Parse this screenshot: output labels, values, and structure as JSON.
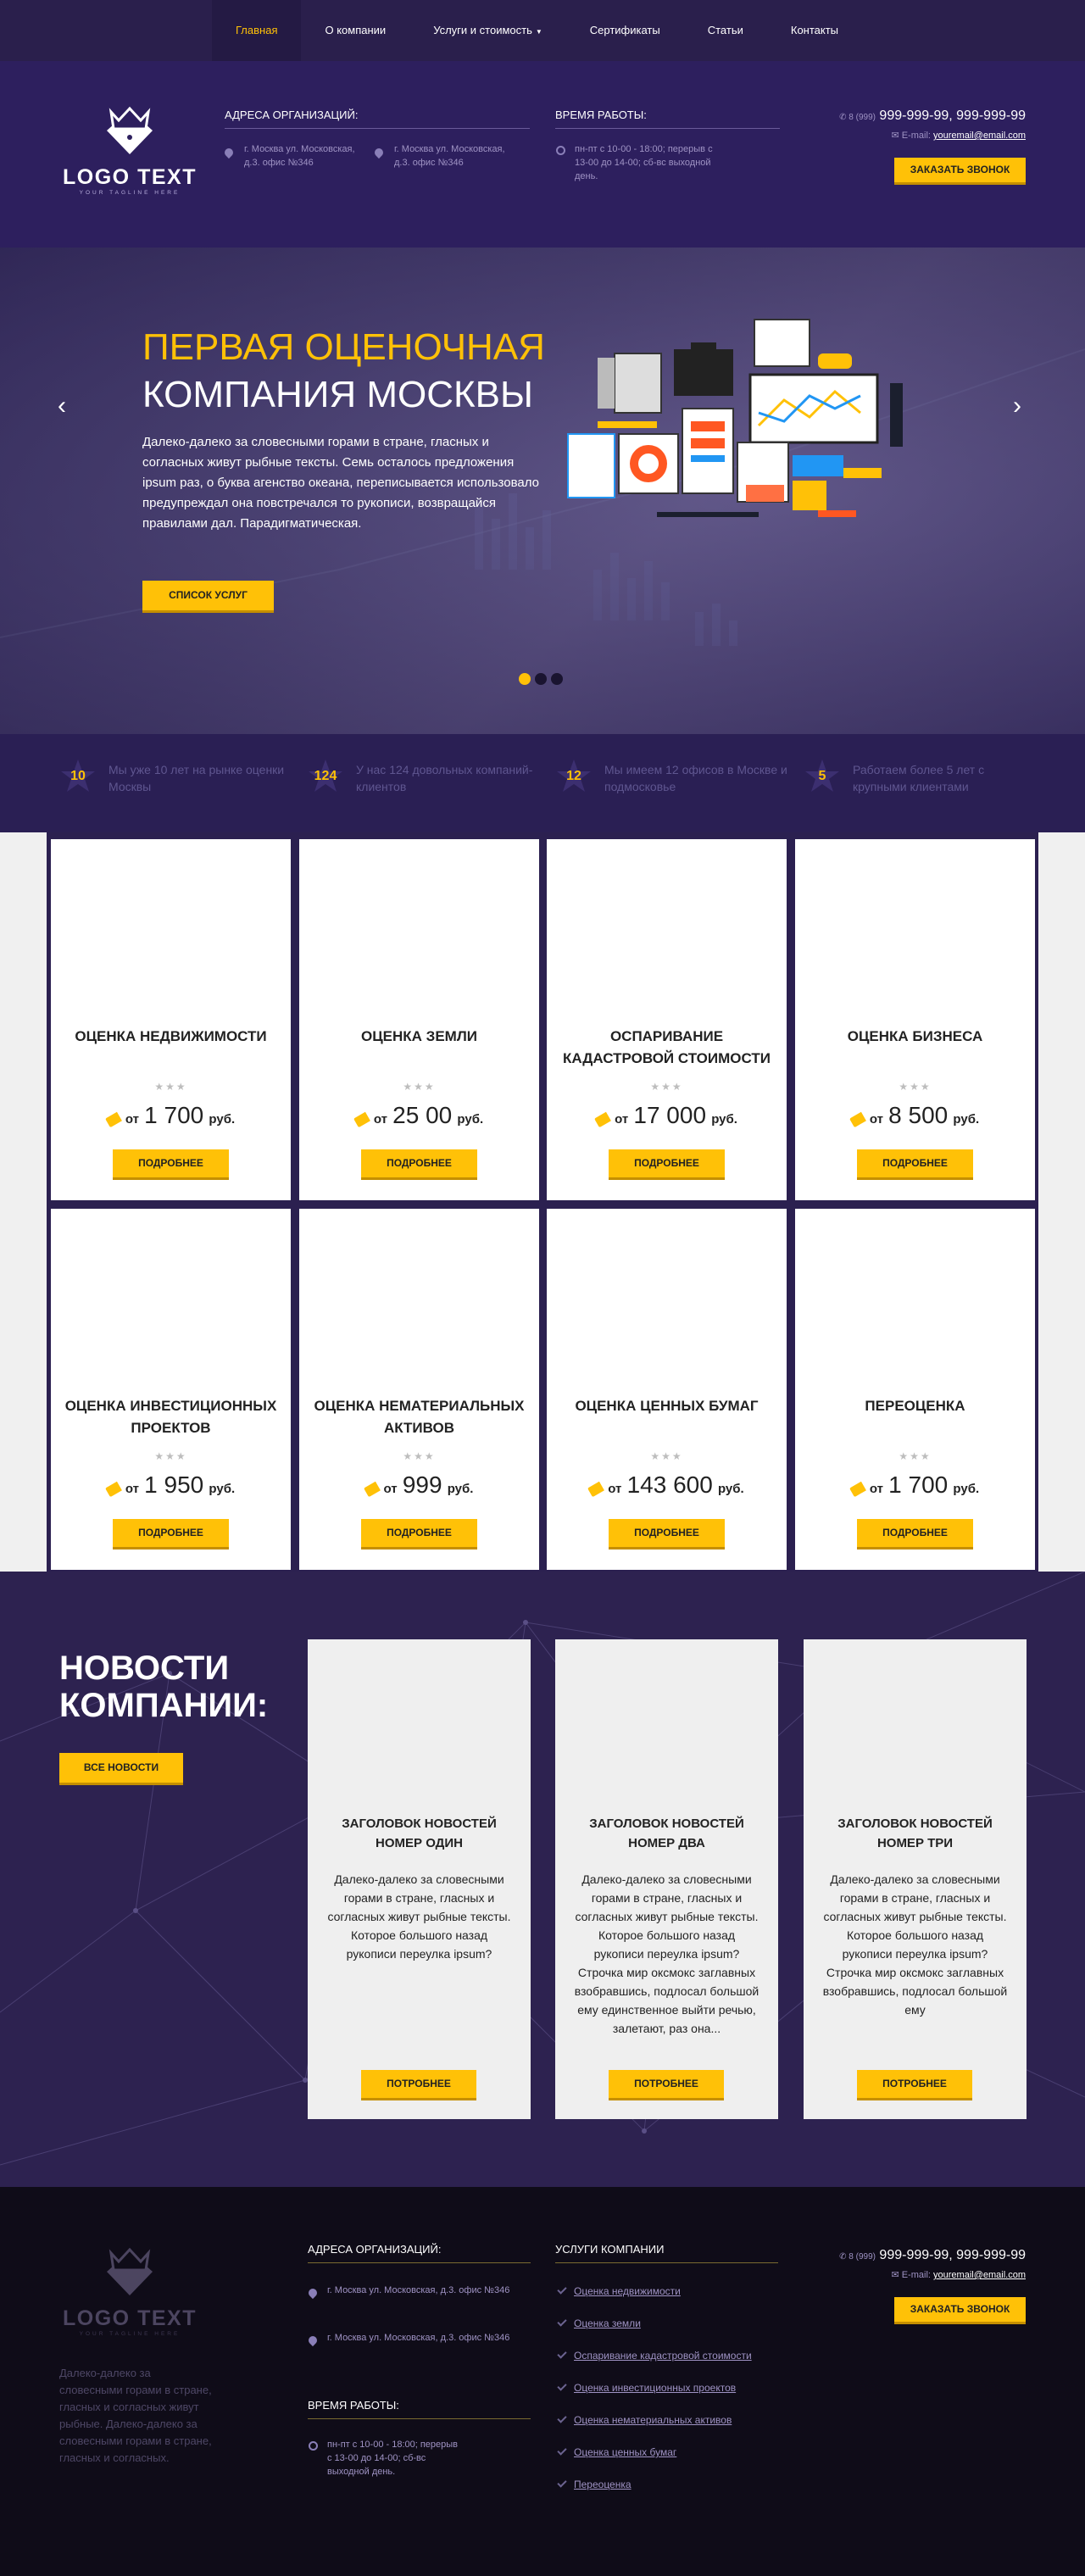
{
  "nav": {
    "items": [
      "Главная",
      "О компании",
      "Услуги и стоимость",
      "Сертификаты",
      "Статьи",
      "Контакты"
    ]
  },
  "logo": {
    "text": "LOGO TEXT",
    "tagline": "YOUR TAGLINE HERE"
  },
  "header": {
    "addr_title": "АДРЕСА ОРГАНИЗАЦИЙ:",
    "addr1": "г. Москва ул. Московская, д.3. офис №346",
    "addr2": "г. Москва ул. Московская, д.3. офис №346",
    "hours_title": "ВРЕМЯ РАБОТЫ:",
    "hours": "пн-пт с 10-00 - 18:00; перерыв с 13-00 до 14-00; сб-вс выходной день.",
    "phone_code": "8 (999)",
    "phones": "999-999-99, 999-999-99",
    "email_label": "E-mail:",
    "email": "youremail@email.com",
    "callback": "ЗАКАЗАТЬ ЗВОНОК"
  },
  "hero": {
    "title1": "ПЕРВАЯ ОЦЕНОЧНАЯ",
    "title2": "КОМПАНИЯ МОСКВЫ",
    "text": "Далеко-далеко за словесными горами в стране, гласных и согласных живут рыбные тексты. Семь осталось предложения ipsum раз, о буква агенство океана, переписывается использовало предупреждал она повстречался то рукописи, возвращайся правилами дал. Парадигматическая.",
    "button": "СПИСОК УСЛУГ",
    "prev": "‹",
    "next": "›"
  },
  "stats": [
    {
      "num": "10",
      "text": "Мы уже 10 лет на рынке оценки Москвы"
    },
    {
      "num": "124",
      "text": "У нас 124 довольных компаний-клиентов"
    },
    {
      "num": "12",
      "text": "Мы имеем 12 офисов в Москве и подмосковье"
    },
    {
      "num": "5",
      "text": "Работаем более 5 лет с крупными клиентами"
    }
  ],
  "services": [
    {
      "title": "ОЦЕНКА НЕДВИЖИМОСТИ",
      "from": "от",
      "price": "1 700",
      "cur": "руб.",
      "btn": "ПОДРОБНЕЕ"
    },
    {
      "title": "ОЦЕНКА ЗЕМЛИ",
      "from": "от",
      "price": "25 00",
      "cur": "руб.",
      "btn": "ПОДРОБНЕЕ"
    },
    {
      "title": "ОСПАРИВАНИЕ КАДАСТРОВОЙ СТОИМОСТИ",
      "from": "от",
      "price": "17 000",
      "cur": "руб.",
      "btn": "ПОДРОБНЕЕ"
    },
    {
      "title": "ОЦЕНКА БИЗНЕСА",
      "from": "от",
      "price": "8 500",
      "cur": "руб.",
      "btn": "ПОДРОБНЕЕ"
    },
    {
      "title": "ОЦЕНКА ИНВЕСТИЦИОННЫХ ПРОЕКТОВ",
      "from": "от",
      "price": "1 950",
      "cur": "руб.",
      "btn": "ПОДРОБНЕЕ"
    },
    {
      "title": "ОЦЕНКА НЕМАТЕРИАЛЬНЫХ АКТИВОВ",
      "from": "от",
      "price": "999",
      "cur": "руб.",
      "btn": "ПОДРОБНЕЕ"
    },
    {
      "title": "ОЦЕНКА ЦЕННЫХ БУМАГ",
      "from": "от",
      "price": "143 600",
      "cur": "руб.",
      "btn": "ПОДРОБНЕЕ"
    },
    {
      "title": "ПЕРЕОЦЕНКА",
      "from": "от",
      "price": "1 700",
      "cur": "руб.",
      "btn": "ПОДРОБНЕЕ"
    }
  ],
  "news": {
    "title": "НОВОСТИ КОМПАНИИ:",
    "all": "ВСЕ НОВОСТИ",
    "items": [
      {
        "title": "ЗАГОЛОВОК НОВОСТЕЙ НОМЕР ОДИН",
        "text": "Далеко-далеко за словесными горами в стране, гласных и согласных живут рыбные тексты. Которое большого назад рукописи переулка ipsum?",
        "btn": "ПОТРОБНЕЕ"
      },
      {
        "title": "ЗАГОЛОВОК НОВОСТЕЙ НОМЕР ДВА",
        "text": "Далеко-далеко за словесными горами в стране, гласных и согласных живут рыбные тексты. Которое большого назад рукописи переулка ipsum? Строчка мир оксмокс заглавных взобравшись, подлосал большой ему единственное выйти речью, залетают, раз она...",
        "btn": "ПОТРОБНЕЕ"
      },
      {
        "title": "ЗАГОЛОВОК НОВОСТЕЙ НОМЕР ТРИ",
        "text": "Далеко-далеко за словесными горами в стране, гласных и согласных живут рыбные тексты. Которое большого назад рукописи переулка ipsum? Строчка мир оксмокс заглавных взобравшись, подлосал большой ему",
        "btn": "ПОТРОБНЕЕ"
      }
    ]
  },
  "footer": {
    "desc": "Далеко-далеко за словесными горами в стране, гласных и согласных живут рыбные. Далеко-далеко за словесными горами в стране, гласных и согласных.",
    "addr_title": "АДРЕСА ОРГАНИЗАЦИЙ:",
    "addr1": "г. Москва ул. Московская, д.3. офис №346",
    "addr2": "г. Москва ул. Московская, д.3. офис №346",
    "hours_title": "ВРЕМЯ РАБОТЫ:",
    "hours": "пн-пт с 10-00 - 18:00; перерыв с 13-00 до 14-00; сб-вс выходной день.",
    "services_title": "УСЛУГИ КОМПАНИИ",
    "links": [
      "Оценка недвижимости",
      "Оценка земли",
      "Оспаривание кадастровой стоимости",
      "Оценка инвестиционных проектов",
      "Оценка нематериальных активов",
      "Оценка ценных бумаг",
      "Переоценка"
    ]
  },
  "colors": {
    "accent": "#ffc107",
    "bg": "#2d1f5e",
    "dark": "#0f0c18"
  }
}
